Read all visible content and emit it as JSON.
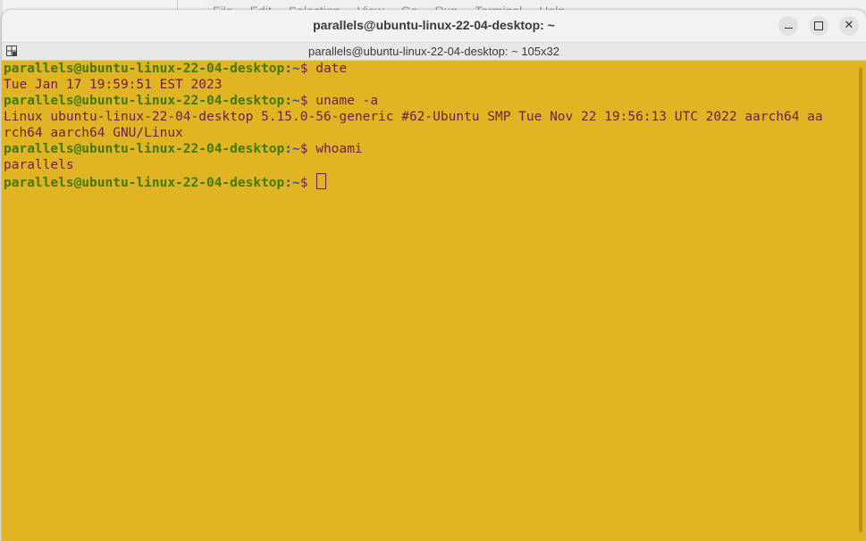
{
  "background_app": {
    "menu": [
      "File",
      "Edit",
      "Selection",
      "View",
      "Go",
      "Run",
      "Terminal",
      "Help"
    ]
  },
  "window": {
    "title": "parallels@ubuntu-linux-22-04-desktop: ~",
    "tab_title": "parallels@ubuntu-linux-22-04-desktop: ~ 105x32",
    "buttons": {
      "minimize_icon": "minimize-icon",
      "maximize_icon": "maximize-icon",
      "close_icon": "close-icon",
      "close_glyph": "✕"
    }
  },
  "colors": {
    "terminal_bg": "#e0b422",
    "prompt_user": "#3f7a0a",
    "prompt_path": "#2a5a9a",
    "text": "#6e1f43"
  },
  "terminal": {
    "prompt_user": "parallels@ubuntu-linux-22-04-desktop",
    "prompt_sep": ":",
    "prompt_path": "~",
    "prompt_sym": "$ ",
    "lines": [
      {
        "type": "prompt",
        "command": "date"
      },
      {
        "type": "output",
        "text": "Tue Jan 17 19:59:51 EST 2023"
      },
      {
        "type": "prompt",
        "command": "uname -a"
      },
      {
        "type": "output",
        "text": "Linux ubuntu-linux-22-04-desktop 5.15.0-56-generic #62-Ubuntu SMP Tue Nov 22 19:56:13 UTC 2022 aarch64 aa"
      },
      {
        "type": "output",
        "text": "rch64 aarch64 GNU/Linux"
      },
      {
        "type": "prompt",
        "command": "whoami"
      },
      {
        "type": "output",
        "text": "parallels"
      },
      {
        "type": "prompt",
        "command": "",
        "cursor": true
      }
    ]
  }
}
